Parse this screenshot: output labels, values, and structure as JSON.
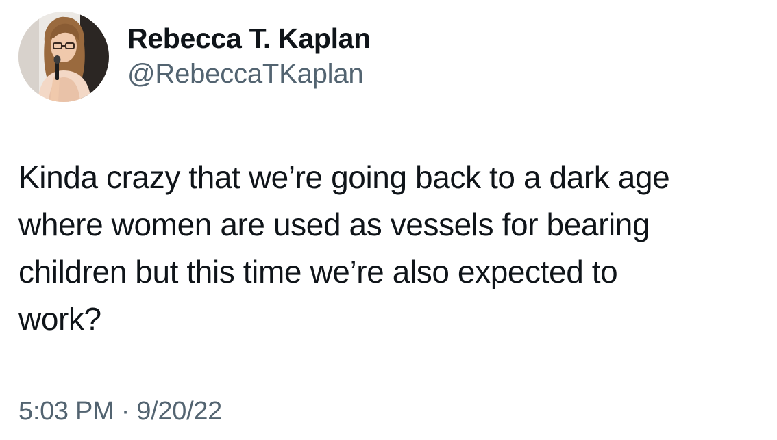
{
  "author": {
    "display_name": "Rebecca T. Kaplan",
    "handle": "@RebeccaTKaplan",
    "avatar_icon": "profile-photo"
  },
  "tweet": {
    "lines": [
      "Kinda crazy that we’re going back to a dark age",
      "where women are used as vessels for bearing",
      "children but this time we’re also expected to",
      "work?"
    ],
    "time": "5:03 PM",
    "separator": "·",
    "date": "9/20/22"
  },
  "colors": {
    "text_primary": "#0f1419",
    "text_secondary": "#536471",
    "background": "#ffffff"
  }
}
